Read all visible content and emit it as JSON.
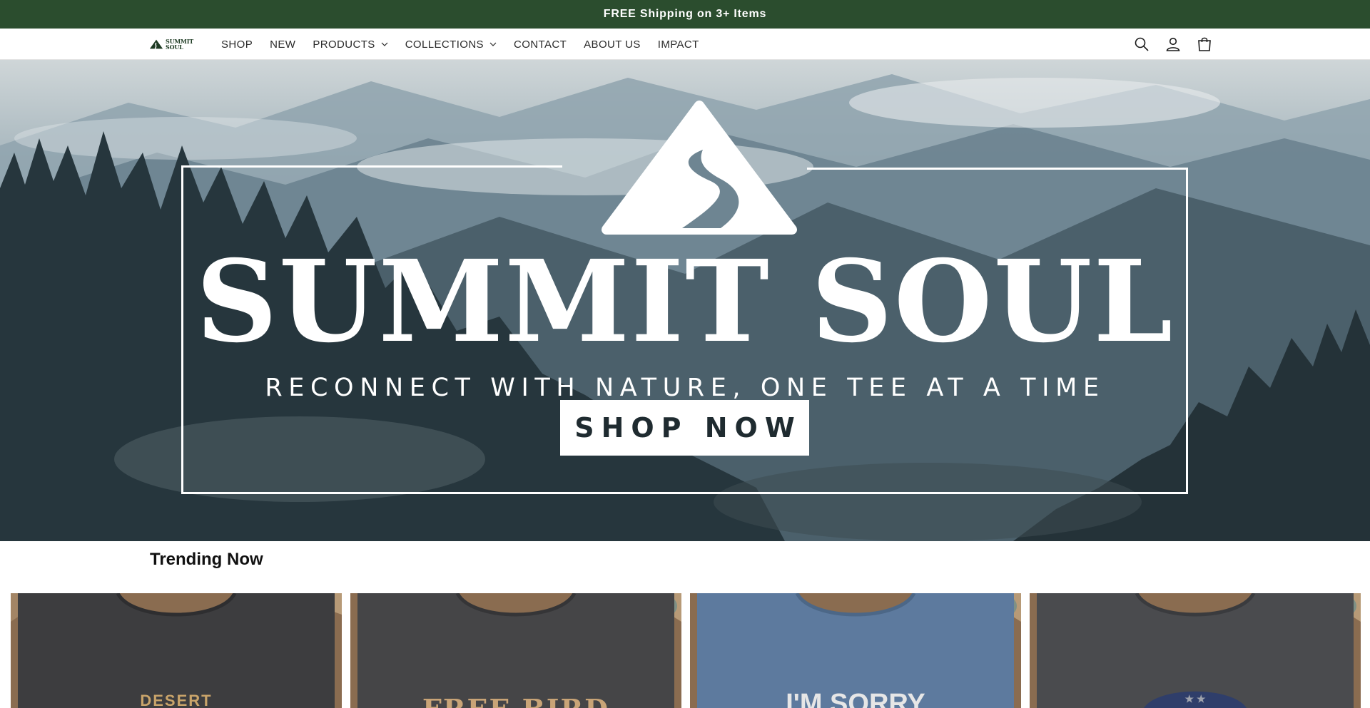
{
  "announcement": {
    "text": "FREE Shipping on 3+ Items"
  },
  "header": {
    "logo": {
      "line1": "SUMMIT",
      "line2": "SOUL"
    },
    "nav": [
      {
        "label": "SHOP",
        "has_dropdown": false
      },
      {
        "label": "NEW",
        "has_dropdown": false
      },
      {
        "label": "PRODUCTS",
        "has_dropdown": true
      },
      {
        "label": "COLLECTIONS",
        "has_dropdown": true
      },
      {
        "label": "CONTACT",
        "has_dropdown": false
      },
      {
        "label": "ABOUT US",
        "has_dropdown": false
      },
      {
        "label": "IMPACT",
        "has_dropdown": false
      }
    ],
    "icons": [
      "search-icon",
      "account-icon",
      "cart-icon"
    ]
  },
  "hero": {
    "title": "SUMMIT SOUL",
    "tagline": "RECONNECT WITH NATURE, ONE TEE AT A TIME",
    "cta_label": "SHOP NOW"
  },
  "trending": {
    "title": "Trending Now",
    "products": [
      {
        "shirt_color": "#3d3d3f",
        "print_text": "DESERT",
        "print_color": "#c9a46a"
      },
      {
        "shirt_color": "#454547",
        "print_text": "FREE BIRD",
        "print_color": "#c9a477"
      },
      {
        "shirt_color": "#5d7a9e",
        "print_text": "I'M SORRY",
        "print_color": "#e6e6e6"
      },
      {
        "shirt_color": "#4a4b4e",
        "print_text": "★ ★",
        "print_color": "#9fa3ad"
      }
    ]
  },
  "colors": {
    "announcement_bg": "#2b4d2e",
    "header_bg": "#ffffff",
    "cta_bg": "#ffffff",
    "cta_text": "#1f2b30"
  }
}
